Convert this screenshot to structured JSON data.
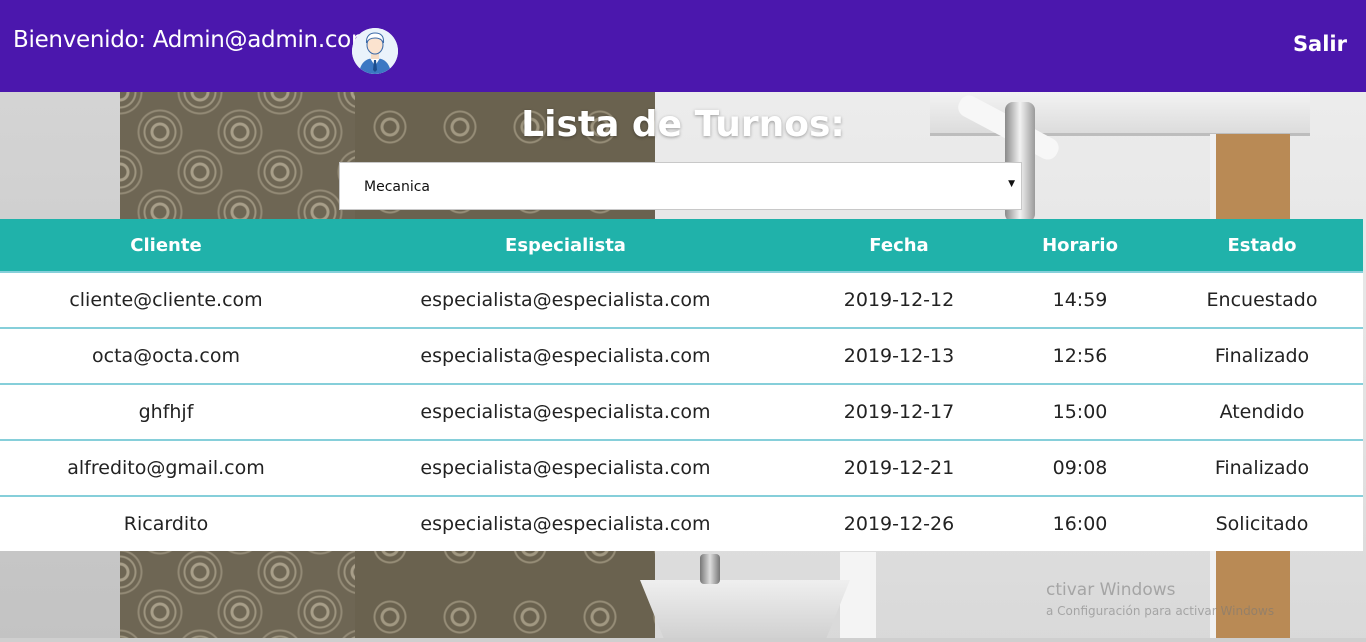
{
  "header": {
    "welcome": "Bienvenido: Admin@admin.com",
    "logout_label": "Salir",
    "avatar_icon": "user-avatar-icon",
    "background_color": "#4b17ad"
  },
  "main": {
    "title": "Lista de Turnos:",
    "specialty_select": {
      "selected": "Mecanica"
    }
  },
  "table": {
    "header_color": "#20b2aa",
    "columns": [
      "Cliente",
      "Especialista",
      "Fecha",
      "Horario",
      "Estado"
    ],
    "rows": [
      [
        "cliente@cliente.com",
        "especialista@especialista.com",
        "2019-12-12",
        "14:59",
        "Encuestado"
      ],
      [
        "octa@octa.com",
        "especialista@especialista.com",
        "2019-12-13",
        "12:56",
        "Finalizado"
      ],
      [
        "ghfhjf",
        "especialista@especialista.com",
        "2019-12-17",
        "15:00",
        "Atendido"
      ],
      [
        "alfredito@gmail.com",
        "especialista@especialista.com",
        "2019-12-21",
        "09:08",
        "Finalizado"
      ],
      [
        "Ricardito",
        "especialista@especialista.com",
        "2019-12-26",
        "16:00",
        "Solicitado"
      ]
    ]
  },
  "watermark": {
    "line1": "ctivar Windows",
    "line2": "a Configuración para activar Windows"
  }
}
